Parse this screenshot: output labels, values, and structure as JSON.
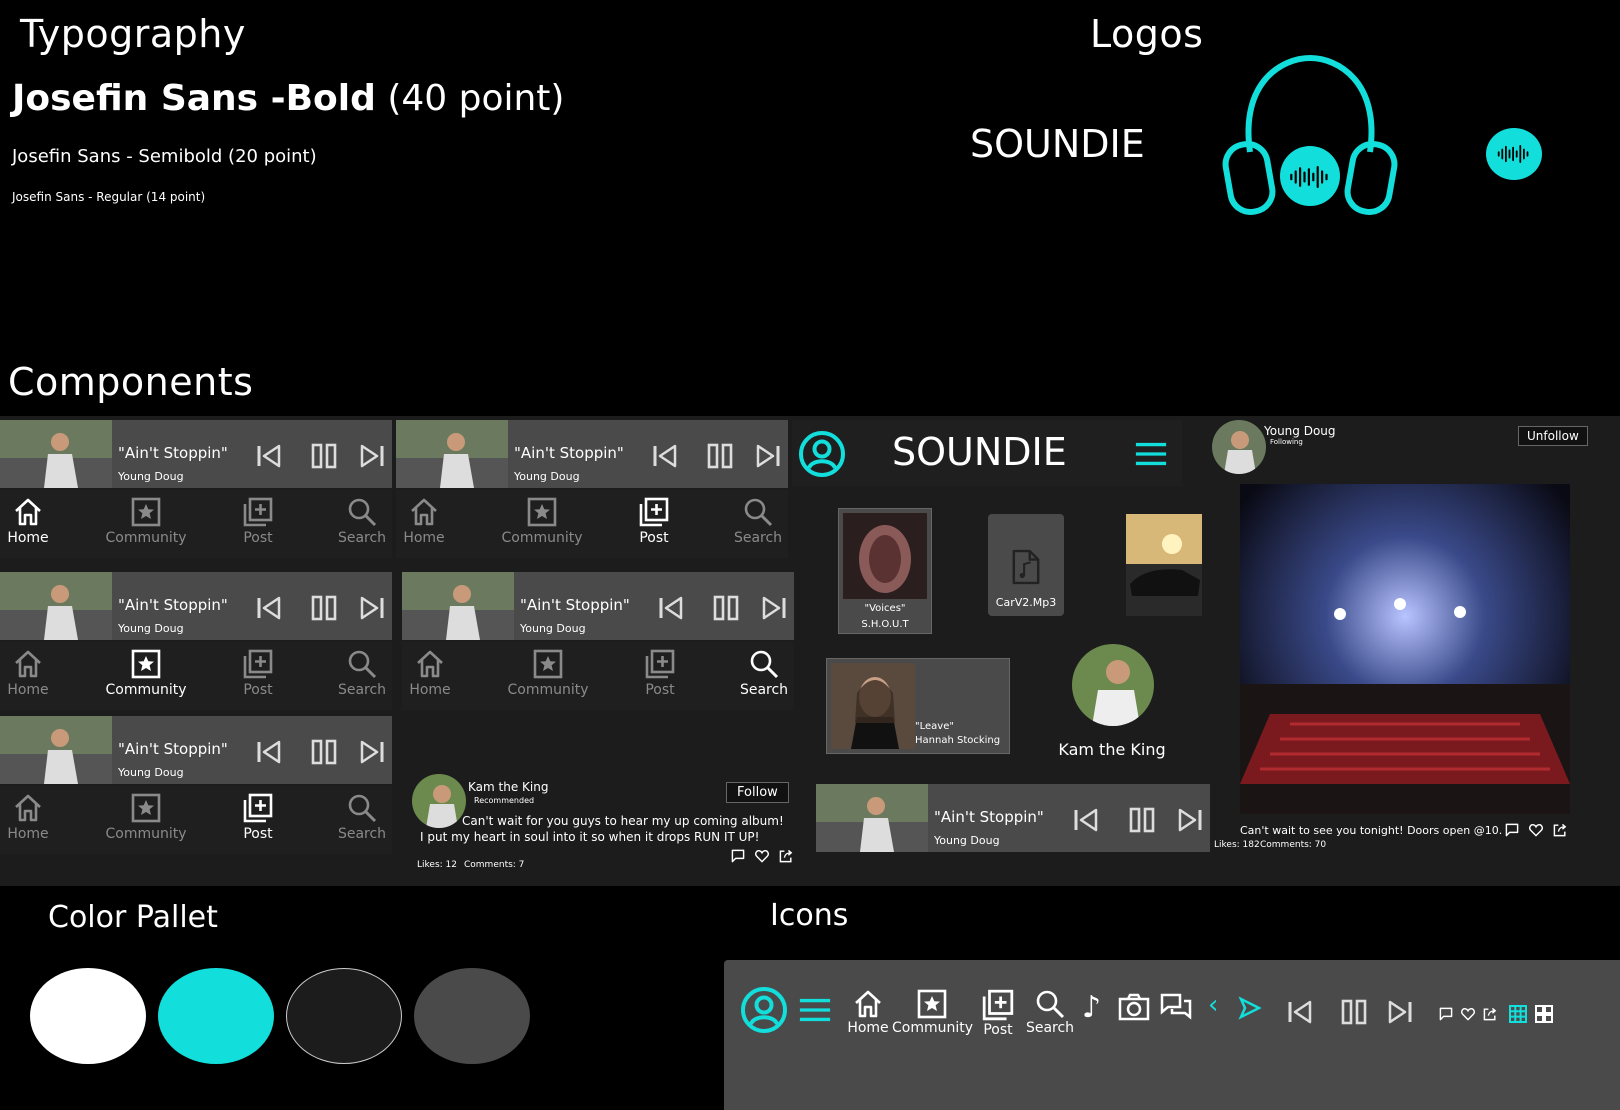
{
  "colors": {
    "cyan": "#12DEDB",
    "white": "#FFFFFF",
    "dark": "#1C1C1C",
    "grey": "#4A4A4A"
  },
  "sections": {
    "typography": "Typography",
    "logos": "Logos",
    "components": "Components",
    "color_pallet": "Color Pallet",
    "icons": "Icons"
  },
  "typography": {
    "bold_name": "Josefin Sans -Bold",
    "bold_size": "(40 point)",
    "semibold": "Josefin Sans - Semibold (20 point)",
    "regular": "Josefin Sans - Regular (14 point)"
  },
  "logo": {
    "wordmark": "SOUNDIE"
  },
  "player": {
    "title": "\"Ain't Stoppin\"",
    "artist": "Young Doug"
  },
  "nav": {
    "home": "Home",
    "community": "Community",
    "post": "Post",
    "search": "Search"
  },
  "header": {
    "brand": "SOUNDIE"
  },
  "tiles": {
    "voices_title": "\"Voices\"",
    "voices_artist": "S.H.O.U.T",
    "file_name": "CarV2.Mp3",
    "leave_title": "\"Leave\"",
    "leave_artist": "Hannah Stocking",
    "profile_name": "Kam the King"
  },
  "post_small": {
    "author": "Kam the King",
    "tag": "Recommended",
    "follow": "Follow",
    "text1": "Can't wait for you guys to hear my up coming album!",
    "text2": "I put my heart in soul into it so when it drops RUN IT UP!",
    "likes": "Likes: 12",
    "comments": "Comments: 7"
  },
  "post_large": {
    "author": "Young Doug",
    "tag": "Following",
    "unfollow": "Unfollow",
    "text": "Can't wait to see you tonight! Doors open @10.",
    "likes": "Likes: 182",
    "comments": "Comments: 70"
  },
  "icon_bar": {
    "home": "Home",
    "community": "Community",
    "post": "Post",
    "search": "Search"
  }
}
